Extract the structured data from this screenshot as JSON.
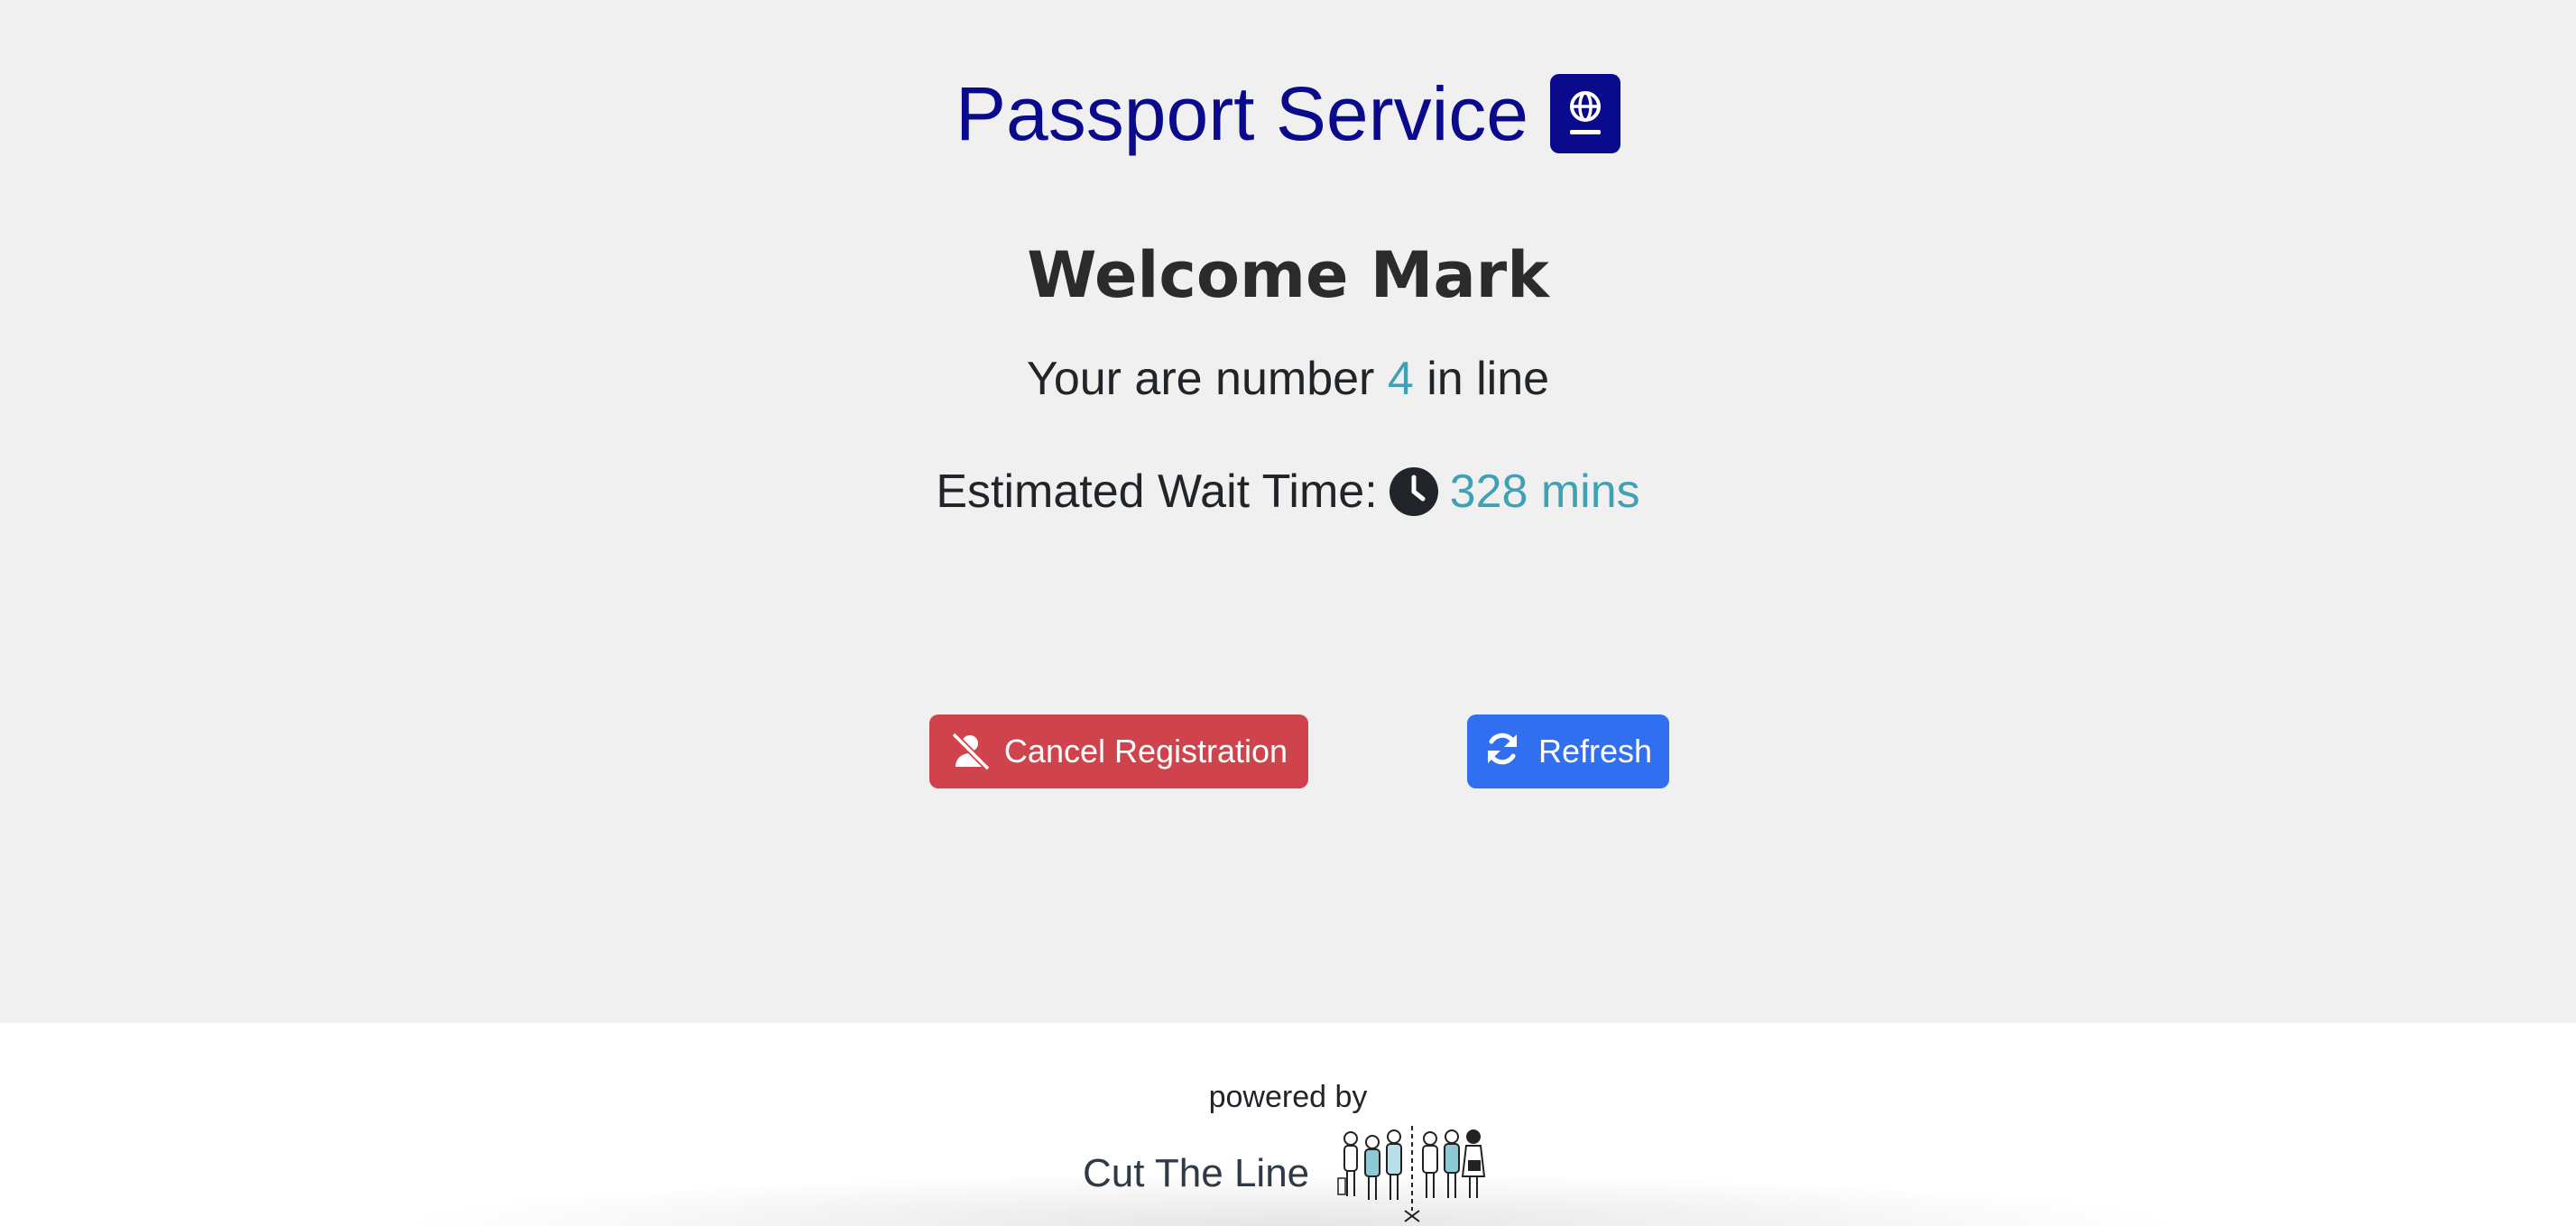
{
  "header": {
    "title": "Passport Service",
    "icon": "passport-icon",
    "title_color": "#0a0a8c"
  },
  "welcome": {
    "text": "Welcome Mark"
  },
  "queue": {
    "prefix": "Your are number",
    "position": "4",
    "suffix": "in line"
  },
  "wait": {
    "label": "Estimated Wait Time:",
    "icon": "clock-icon",
    "value": "328 mins"
  },
  "actions": {
    "cancel_label": "Cancel Registration",
    "cancel_icon": "user-slash-icon",
    "cancel_color": "#cf444c",
    "refresh_label": "Refresh",
    "refresh_icon": "sync-icon",
    "refresh_color": "#2f6ff0"
  },
  "footer": {
    "powered_by": "powered by",
    "brand": "Cut The Line",
    "illustration": "queue-people-illustration"
  },
  "colors": {
    "accent": "#3ea1b5",
    "background": "#f0f0f0"
  }
}
